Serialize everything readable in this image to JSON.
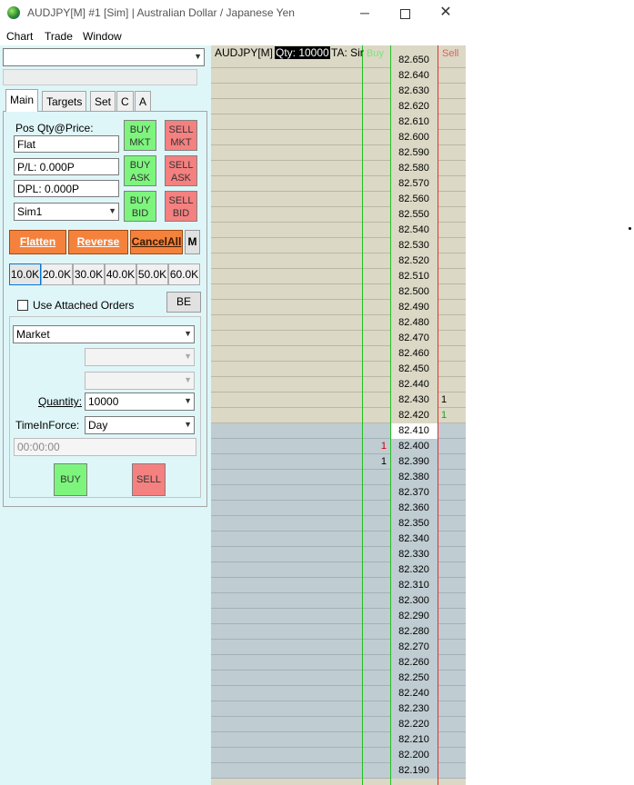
{
  "window": {
    "title": "AUDJPY[M]  #1 [Sim]  | Australian Dollar / Japanese Yen",
    "minimize_glyph": "─",
    "close_glyph": "✕"
  },
  "menu": [
    "Chart",
    "Trade",
    "Window"
  ],
  "tabs": [
    "Main",
    "Targets",
    "Set",
    "C",
    "A"
  ],
  "main_tab": {
    "pos_label": "Pos Qty@Price:",
    "pos_value": "Flat",
    "pl_value": "P/L: 0.000P",
    "dpl_value": "DPL: 0.000P",
    "account": "Sim1",
    "buy_mkt": [
      "BUY",
      "MKT"
    ],
    "sell_mkt": [
      "SELL",
      "MKT"
    ],
    "buy_ask": [
      "BUY",
      "ASK"
    ],
    "sell_ask": [
      "SELL",
      "ASK"
    ],
    "buy_bid": [
      "BUY",
      "BID"
    ],
    "sell_bid": [
      "SELL",
      "BID"
    ],
    "flatten": "Flatten",
    "reverse": "Reverse",
    "cancel_all": "CancelAll",
    "m": "M",
    "qty_presets": [
      "10.0K",
      "20.0K",
      "30.0K",
      "40.0K",
      "50.0K",
      "60.0K"
    ],
    "use_attached_orders": "Use Attached Orders",
    "be": "BE",
    "order_type": "Market",
    "quantity_label": "Quantity:",
    "quantity_value": "10000",
    "tif_label": "TimeInForce:",
    "tif_value": "Day",
    "time_value": "00:00:00",
    "buy": "BUY",
    "sell": "SELL"
  },
  "dom": {
    "symbol": "AUDJPY[M]",
    "qty": "Qty: 10000",
    "ta": "TA: Sin",
    "buy_header": "Buy",
    "sell_header": "Sell",
    "prices": [
      "82.650",
      "82.640",
      "82.630",
      "82.620",
      "82.610",
      "82.600",
      "82.590",
      "82.580",
      "82.570",
      "82.560",
      "82.550",
      "82.540",
      "82.530",
      "82.520",
      "82.510",
      "82.500",
      "82.490",
      "82.480",
      "82.470",
      "82.460",
      "82.450",
      "82.440",
      "82.430",
      "82.420",
      "82.410",
      "82.400",
      "82.390",
      "82.380",
      "82.370",
      "82.360",
      "82.350",
      "82.340",
      "82.330",
      "82.320",
      "82.310",
      "82.300",
      "82.290",
      "82.280",
      "82.270",
      "82.260",
      "82.250",
      "82.240",
      "82.230",
      "82.220",
      "82.210",
      "82.200",
      "82.190"
    ],
    "last_price": "82.410",
    "ask_sizes": {
      "82.430": "1",
      "82.420": "1"
    },
    "bid_sizes": {
      "82.400": "1",
      "82.390": "1"
    },
    "colors": {
      "buy": "#20c020",
      "sell": "#e03030",
      "ask_side": "#dbd8c5",
      "bid_side": "#bfccd2"
    }
  }
}
